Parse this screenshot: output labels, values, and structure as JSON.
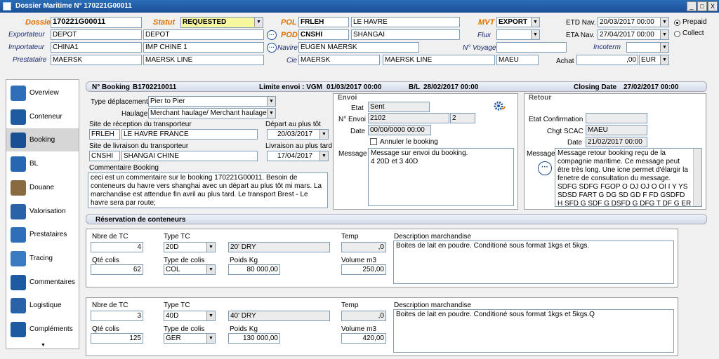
{
  "window": {
    "title": "Dossier Maritime N° 170221G00011",
    "min": "_",
    "max": "□",
    "close": "X"
  },
  "header": {
    "dossier_label": "Dossier",
    "dossier": "170221G00011",
    "statut_label": "Statut",
    "statut": "REQUESTED",
    "pol_label": "POL",
    "pol_code": "FRLEH",
    "pol_name": "LE HAVRE",
    "pod_label": "POD",
    "pod_code": "CNSHI",
    "pod_name": "SHANGAI",
    "mvt_label": "MVT",
    "mvt": "EXPORT",
    "etd_label": "ETD Nav.",
    "etd": "20/03/2017 00:00",
    "eta_label": "ETA Nav.",
    "eta": "27/04/2017 00:00",
    "prepaid": "Prepaid",
    "collect": "Collect",
    "exportateur_label": "Exportateur",
    "exportateur_code": "DEPOT",
    "exportateur_name": "DEPOT",
    "importateur_label": "Importateur",
    "importateur_code": "CHINA1",
    "importateur_name": "IMP CHINE 1",
    "prestataire_label": "Prestataire",
    "prestataire_code": "MAERSK",
    "prestataire_name": "MAERSK LINE",
    "navire_label": "Navire",
    "navire": "EUGEN MAERSK",
    "cie_label": "Cie",
    "cie_code": "MAERSK",
    "cie_name": "MAERSK LINE",
    "cie_scac": "MAEU",
    "flux_label": "Flux",
    "voyage_label": "N° Voyage",
    "incoterm_label": "Incoterm",
    "achat_label": "Achat",
    "achat": ",00",
    "currency": "EUR"
  },
  "sidebar": {
    "items": [
      {
        "label": "Overview",
        "color": "#2f6fb8"
      },
      {
        "label": "Conteneur",
        "color": "#1e5aa0"
      },
      {
        "label": "Booking",
        "color": "#1a4f92"
      },
      {
        "label": "BL",
        "color": "#2766b0"
      },
      {
        "label": "Douane",
        "color": "#8a6a40"
      },
      {
        "label": "Valorisation",
        "color": "#2a62a8"
      },
      {
        "label": "Prestataires",
        "color": "#2f6fb8"
      },
      {
        "label": "Tracing",
        "color": "#3a7ac0"
      },
      {
        "label": "Commentaires",
        "color": "#1e5aa0"
      },
      {
        "label": "Logistique",
        "color": "#2a62a8"
      },
      {
        "label": "Compléments",
        "color": "#1e5aa0"
      }
    ],
    "more": "▼"
  },
  "booking_bar": {
    "booking_label": "N° Booking",
    "booking": "B1702210011",
    "limite_label": "Limite envoi : VGM",
    "limite": "01/03/2017 00:00",
    "bl_label": "B/L",
    "bl": "28/02/2017 00:00",
    "closing_label": "Closing Date",
    "closing": "27/02/2017 00:00"
  },
  "booking": {
    "type_dep_label": "Type déplacement",
    "type_dep": "Pier to Pier",
    "haulage_label": "Haulage",
    "haulage": "Merchant haulage/ Merchant haulage",
    "site_rec_label": "Site de réception du transporteur",
    "site_rec_code": "FRLEH",
    "site_rec_name": "LE HAVRE  FRANCE",
    "depart_label": "Départ au plus tôt",
    "depart": "20/03/2017",
    "site_liv_label": "Site de livraison du transporteur",
    "site_liv_code": "CNSHI",
    "site_liv_name": "SHANGAI  CHINE",
    "livraison_label": "Livraison au plus tard",
    "livraison": "17/04/2017",
    "comment_label": "Commentaire Booking",
    "comment": "ceci est un commentaire sur le booking 170221G00011. Besoin de conteneurs du havre vers shanghai avec un départ au plus tôt mi mars. La marchandise est attendue fin avril au plus tard.  Le transport Brest - Le havre sera par route;"
  },
  "envoi": {
    "title": "Envoi",
    "etat_label": "Etat",
    "etat": "Sent",
    "n_label": "N° Envoi",
    "n": "2102",
    "n2": "2",
    "date_label": "Date",
    "date": "00/00/0000 00:00",
    "annuler": "Annuler le booking",
    "message_label": "Message",
    "message": "Message sur envoi du booking.\n 4 20D et 3 40D"
  },
  "retour": {
    "title": "Retour",
    "etat_label": "Etat Confirmation",
    "etat": "",
    "scac_label": "Chgt SCAC",
    "scac": "MAEU",
    "date_label": "Date",
    "date": "21/02/2017 00:00",
    "message_label": "Message",
    "message": "Message retour booking reçu de la compagnie maritime. Ce message peut être très long. Une icne permet d'élargir la fenetre de consultation du message.  SDFG SDFG FGOP O OJ OJ O  OI I  Y YS SDSD FART G DG SD GD F FD GSDFD H SFD G SDF G DSFD G DFG T DF G ER T FR TZE R TFD G DFG RG E R G"
  },
  "reservation_bar": "Réservation de conteneurs",
  "containers": [
    {
      "nbre_label": "Nbre de TC",
      "nbre": "4",
      "type_label": "Type TC",
      "type": "20D",
      "type_desc": "20' DRY",
      "temp_label": "Temp",
      "temp": ",0",
      "desc_label": "Description marchandise",
      "desc": "Boites de lait en poudre. Conditioné sous format 1kgs et 5kgs.",
      "qte_label": "Qté colis",
      "qte": "62",
      "colis_label": "Type de colis",
      "colis": "COL",
      "poids_label": "Poids Kg",
      "poids": "80 000,00",
      "vol_label": "Volume m3",
      "vol": "250,00"
    },
    {
      "nbre_label": "Nbre de TC",
      "nbre": "3",
      "type_label": "Type TC",
      "type": "40D",
      "type_desc": "40' DRY",
      "temp_label": "Temp",
      "temp": ",0",
      "desc_label": "Description marchandise",
      "desc": "Boites de lait en poudre. Conditioné sous format 1kgs et 5kgs.Q",
      "qte_label": "Qté colis",
      "qte": "125",
      "colis_label": "Type de colis",
      "colis": "GER",
      "poids_label": "Poids Kg",
      "poids": "130 000,00",
      "vol_label": "Volume m3",
      "vol": "420,00"
    }
  ]
}
